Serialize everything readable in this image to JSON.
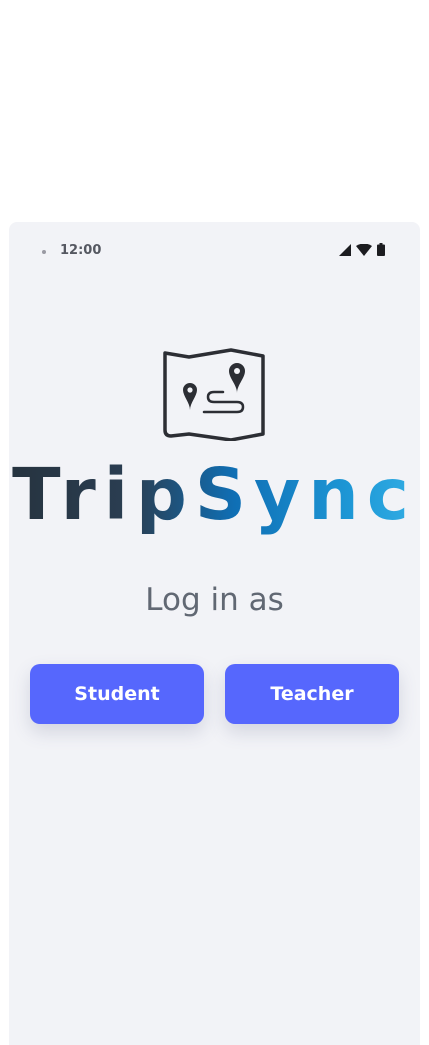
{
  "status_bar": {
    "time": "12:00",
    "icons": [
      "signal-icon",
      "wifi-icon",
      "battery-icon"
    ]
  },
  "app": {
    "logo_icon": "map-route-icon",
    "brand_name": "TripSync",
    "brand_gradient": [
      "#26333f",
      "#0f6fb5",
      "#34aee4"
    ]
  },
  "login": {
    "label": "Log in as",
    "student_button": "Student",
    "teacher_button": "Teacher",
    "button_color": "#5667fd"
  }
}
